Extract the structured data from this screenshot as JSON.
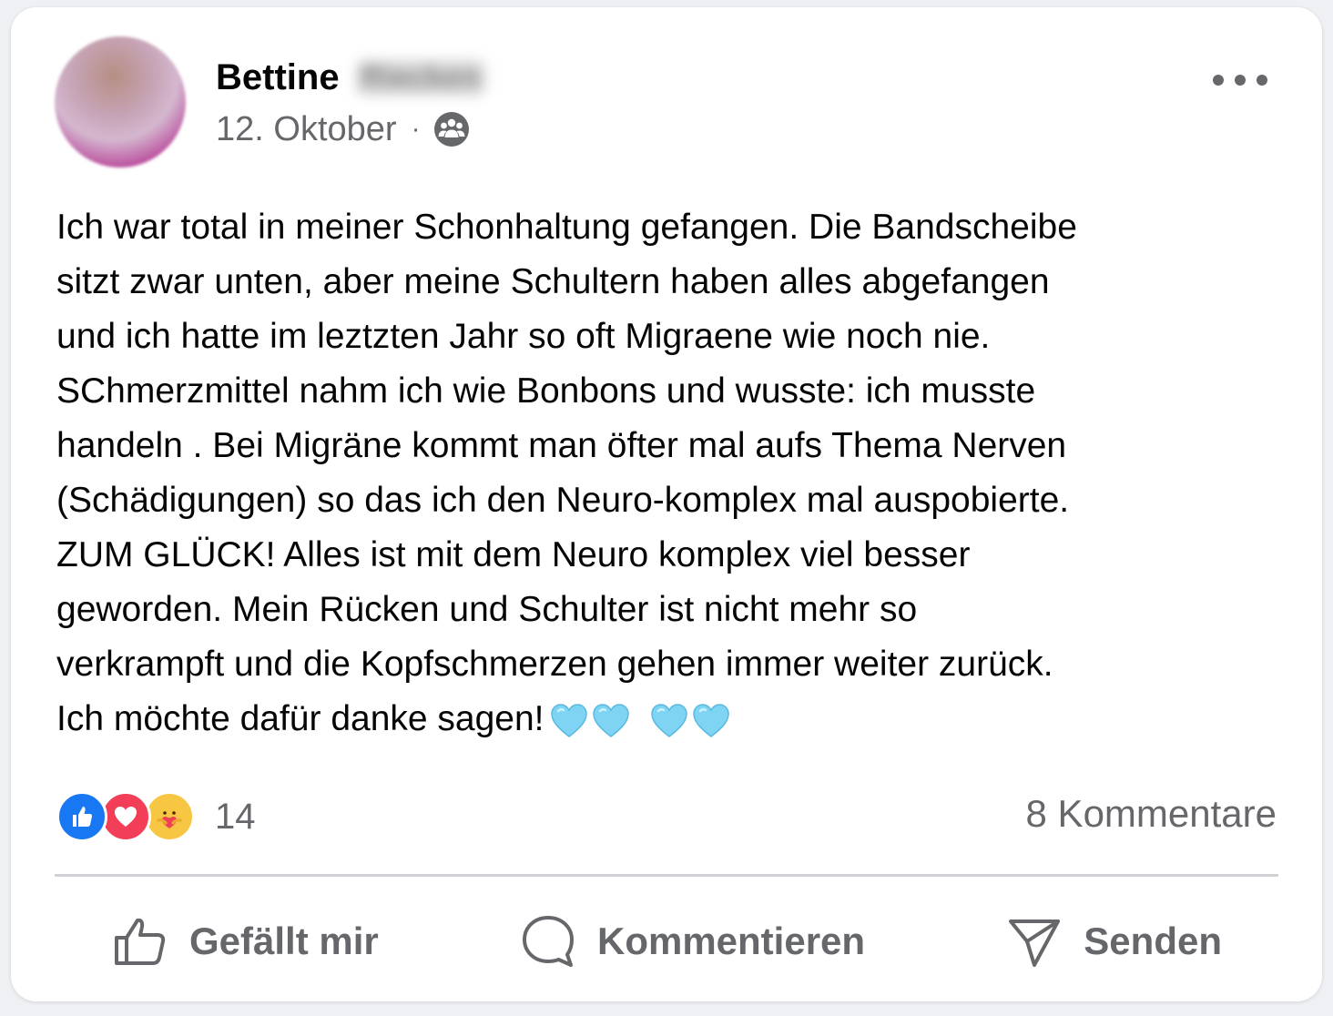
{
  "post": {
    "author_first": "Bettine",
    "author_last": "Riecken",
    "date": "12. Oktober",
    "separator": "·",
    "audience_icon": "group-icon",
    "body": "Ich war total in meiner Schonhaltung gefangen. Die Bandscheibe\nsitzt zwar unten, aber meine Schultern haben alles abgefangen\nund ich hatte im leztzten Jahr so oft Migraene wie noch nie.\nSChmerzmittel nahm ich wie Bonbons und wusste: ich musste\nhandeln . Bei Migräne kommt man öfter mal aufs Thema Nerven\n(Schädigungen) so das ich den Neuro-komplex mal auspobierte.\nZUM GLÜCK! Alles ist mit dem Neuro komplex viel besser\ngeworden. Mein Rücken und Schulter ist nicht mehr so\nverkrampft und die Kopfschmerzen gehen immer weiter zurück.\nIch möchte dafür danke sagen!",
    "hearts_emoji": "💙💙 💙💙",
    "heart_color": "#7fd3f3"
  },
  "reactions": {
    "types": [
      "like",
      "love",
      "care"
    ],
    "count": "14",
    "comments": "8 Kommentare"
  },
  "actions": {
    "like": "Gefällt mir",
    "comment": "Kommentieren",
    "send": "Senden"
  },
  "colors": {
    "like_blue": "#1877f2",
    "love_red": "#f33e58",
    "secondary_text": "#65676b"
  }
}
